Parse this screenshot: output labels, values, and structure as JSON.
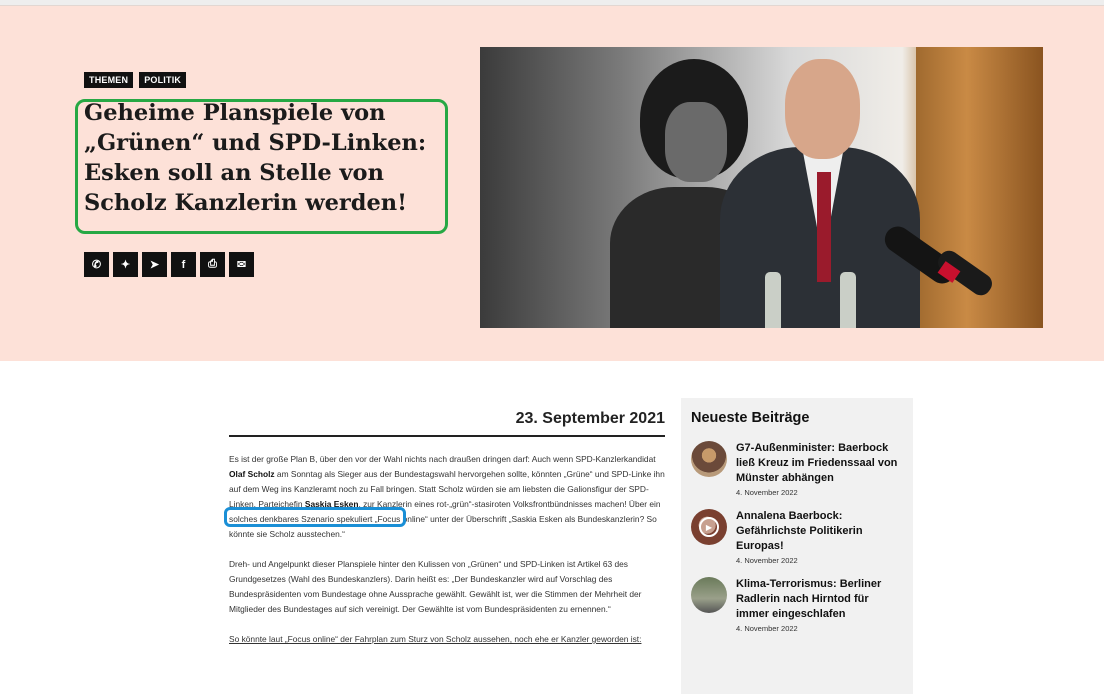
{
  "tags": [
    "THEMEN",
    "POLITIK"
  ],
  "headline": "Geheime Planspiele von „Grünen“ und SPD-Linken: Esken soll an Stelle von Scholz Kanzlerin werden!",
  "share_icons": [
    "whatsapp-icon",
    "twitter-icon",
    "telegram-icon",
    "facebook-icon",
    "print-icon",
    "mail-icon"
  ],
  "share_glyphs": [
    "✆",
    "✦",
    "➤",
    "f",
    "⎙",
    "✉"
  ],
  "article": {
    "date": "23. September 2021",
    "p1_a": "Es ist der große Plan B, über den vor der Wahl nichts nach draußen dringen darf: Auch wenn SPD-Kanzlerkandidat ",
    "p1_b": "Olaf Scholz",
    "p1_c": " am Sonntag als Sieger aus der Bundestagswahl hervorgehen sollte, könnten „Grüne“ und SPD-Linke ihn auf dem Weg ins Kanzleramt noch zu Fall bringen. Statt Scholz würden sie am liebsten die Galionsfigur der SPD-Linken, Parteichefin ",
    "p1_d": "Saskia Esken",
    "p1_e": ", zur Kanzlerin eines rot-„grün“-stasiroten Volksfrontbündnisses machen! Über ein solches denkbares Szenario spekuliert „Focus online“ unter der Überschrift „Saskia Esken als Bundeskanzlerin? So könnte sie Scholz ausstechen.“",
    "p2": "Dreh- und Angelpunkt dieser Planspiele hinter den Kulissen von „Grünen“ und SPD-Linken ist Artikel 63 des Grundgesetzes (Wahl des Bundeskanzlers). Darin heißt es: „Der Bundeskanzler wird auf Vorschlag des Bundespräsidenten vom Bundestage ohne Aussprache gewählt. Gewählt ist, wer die Stimmen der Mehrheit der Mitglieder des Bundestages auf sich vereinigt. Der Gewählte ist vom Bundespräsidenten zu ernennen.“",
    "p3": "So könnte laut „Focus online“ der Fahrplan zum Sturz von Scholz aussehen, noch ehe er Kanzler geworden ist:"
  },
  "sidebar": {
    "title": "Neueste Beiträge",
    "posts": [
      {
        "title": "G7-Außenminister: Baerbock ließ Kreuz im Friedenssaal von Münster abhängen",
        "date": "4. November 2022"
      },
      {
        "title": "Annalena Baerbock: Gefährlichste Politikerin Europas!",
        "date": "4. November 2022"
      },
      {
        "title": "Klima-Terrorismus: Berliner Radlerin nach Hirntod für immer eingeschlafen",
        "date": "4. November 2022"
      }
    ]
  },
  "colors": {
    "hero_bg": "#fde1d8",
    "annotation_green": "#27a844",
    "annotation_blue": "#1a8fd6"
  }
}
